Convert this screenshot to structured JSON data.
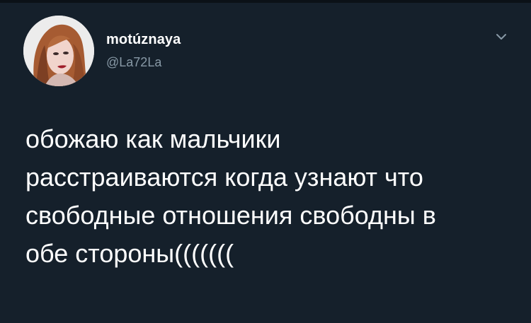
{
  "tweet": {
    "author": {
      "display_name": "motúznaya",
      "handle": "@La72La",
      "avatar_icon": "profile-photo-icon"
    },
    "menu_icon": "chevron-down-icon",
    "text": "обожаю как мальчики\nрасстраиваются когда узнают что\nсвободные отношения свободны в\nобе стороны(((((((",
    "colors": {
      "background": "#15202b",
      "primary_text": "#ffffff",
      "secondary_text": "#8899a6"
    }
  }
}
